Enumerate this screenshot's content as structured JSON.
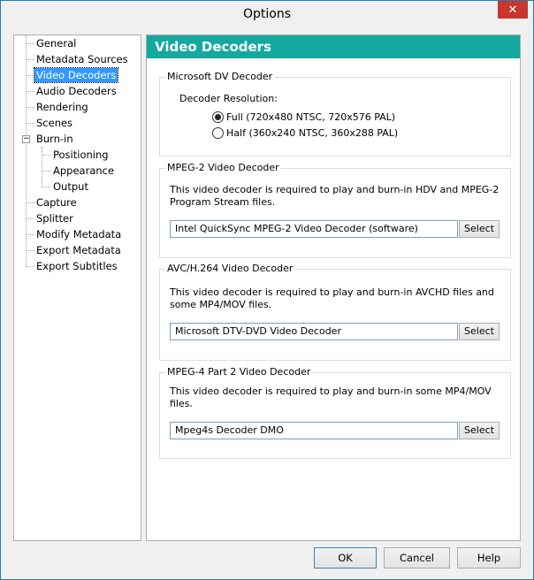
{
  "window": {
    "title": "Options",
    "close_glyph": "✕"
  },
  "sidebar": {
    "items": [
      {
        "label": "General"
      },
      {
        "label": "Metadata Sources"
      },
      {
        "label": "Video Decoders",
        "selected": true
      },
      {
        "label": "Audio Decoders"
      },
      {
        "label": "Rendering"
      },
      {
        "label": "Scenes"
      },
      {
        "label": "Burn-in",
        "expanded": true
      },
      {
        "label": "Positioning"
      },
      {
        "label": "Appearance"
      },
      {
        "label": "Output"
      },
      {
        "label": "Capture"
      },
      {
        "label": "Splitter"
      },
      {
        "label": "Modify Metadata"
      },
      {
        "label": "Export Metadata"
      },
      {
        "label": "Export Subtitles"
      }
    ],
    "expander_glyph": "−"
  },
  "panel": {
    "title": "Video Decoders",
    "header_color": "#14a89f",
    "dv": {
      "legend": "Microsoft DV Decoder",
      "resolution_label": "Decoder Resolution:",
      "options": [
        {
          "label": "Full (720x480 NTSC, 720x576 PAL)",
          "checked": true
        },
        {
          "label": "Half (360x240 NTSC, 360x288 PAL)",
          "checked": false
        }
      ]
    },
    "mpeg2": {
      "legend": "MPEG-2 Video Decoder",
      "description": "This video decoder is required to play and burn-in HDV and MPEG-2 Program Stream files.",
      "value": "Intel QuickSync MPEG-2 Video Decoder (software)",
      "button": "Select"
    },
    "avc": {
      "legend": "AVC/H.264 Video Decoder",
      "description": "This video decoder is required to play and burn-in AVCHD files and some MP4/MOV files.",
      "value": "Microsoft DTV-DVD Video Decoder",
      "button": "Select"
    },
    "mpeg4": {
      "legend": "MPEG-4 Part 2 Video Decoder",
      "description": "This video decoder is required to play and burn-in some MP4/MOV files.",
      "value": "Mpeg4s Decoder DMO",
      "button": "Select"
    }
  },
  "footer": {
    "ok": "OK",
    "cancel": "Cancel",
    "help": "Help"
  }
}
